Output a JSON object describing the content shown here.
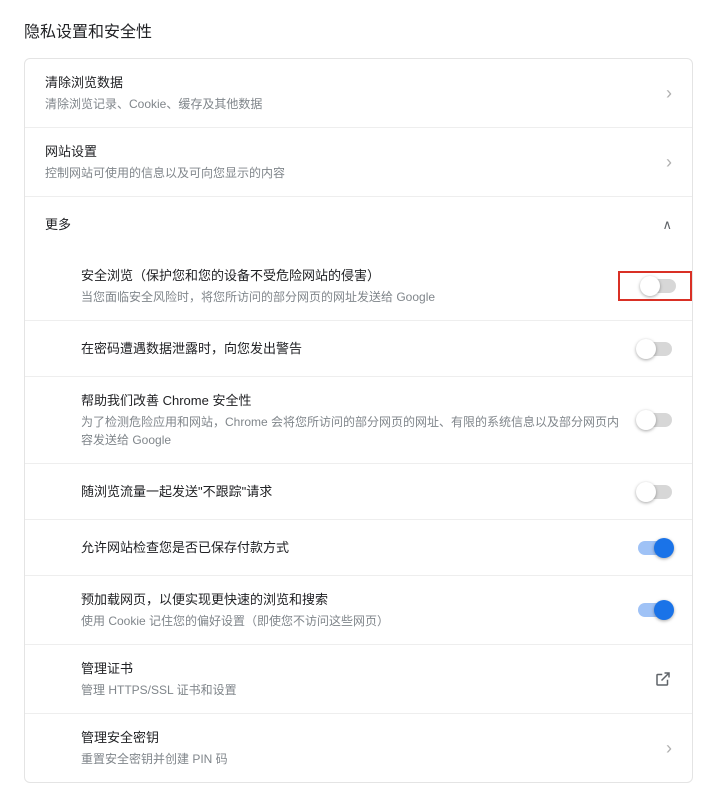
{
  "pageTitle": "隐私设置和安全性",
  "rows": {
    "clearData": {
      "title": "清除浏览数据",
      "desc": "清除浏览记录、Cookie、缓存及其他数据"
    },
    "siteSettings": {
      "title": "网站设置",
      "desc": "控制网站可使用的信息以及可向您显示的内容"
    },
    "more": {
      "title": "更多"
    },
    "safeBrowsing": {
      "title": "安全浏览（保护您和您的设备不受危险网站的侵害）",
      "desc": "当您面临安全风险时，将您所访问的部分网页的网址发送给 Google"
    },
    "passwordLeak": {
      "title": "在密码遭遇数据泄露时，向您发出警告"
    },
    "improveSecurity": {
      "title": "帮助我们改善 Chrome 安全性",
      "desc": "为了检测危险应用和网站，Chrome 会将您所访问的部分网页的网址、有限的系统信息以及部分网页内容发送给 Google"
    },
    "doNotTrack": {
      "title": "随浏览流量一起发送\"不跟踪\"请求"
    },
    "paymentCheck": {
      "title": "允许网站检查您是否已保存付款方式"
    },
    "preload": {
      "title": "预加载网页，以便实现更快速的浏览和搜索",
      "desc": "使用 Cookie 记住您的偏好设置（即使您不访问这些网页）"
    },
    "certs": {
      "title": "管理证书",
      "desc": "管理 HTTPS/SSL 证书和设置"
    },
    "securityKeys": {
      "title": "管理安全密钥",
      "desc": "重置安全密钥并创建 PIN 码"
    }
  },
  "toggles": {
    "safeBrowsing": false,
    "passwordLeak": false,
    "improveSecurity": false,
    "doNotTrack": false,
    "paymentCheck": true,
    "preload": true
  }
}
